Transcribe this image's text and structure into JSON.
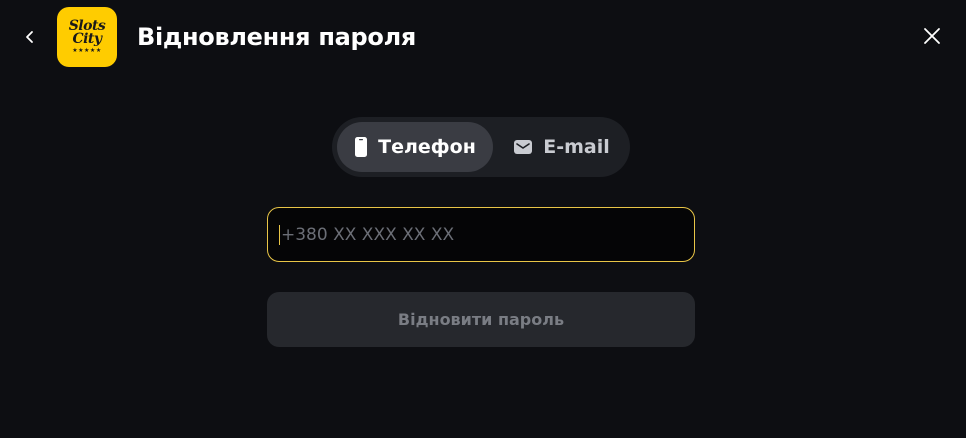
{
  "header": {
    "title": "Відновлення пароля",
    "logo": {
      "line1": "Slots",
      "line2": "City",
      "stars": "★★★★★",
      "color": "#ffcc00"
    },
    "back_icon": "chevron-left-icon",
    "close_icon": "close-icon"
  },
  "tabs": [
    {
      "label": "Телефон",
      "icon": "phone-icon",
      "selected": true
    },
    {
      "label": "E-mail",
      "icon": "mail-icon",
      "selected": false
    }
  ],
  "form": {
    "phone": {
      "value": "",
      "placeholder": "+380 XX XXX XX XX",
      "focused": true
    },
    "submit_label": "Відновити пароль",
    "submit_enabled": false
  },
  "colors": {
    "background": "#0d0e12",
    "focus_border": "#e8c547",
    "tab_active": "#3a3c43",
    "tab_track": "#1d1f24",
    "button_disabled": "#26282d"
  }
}
